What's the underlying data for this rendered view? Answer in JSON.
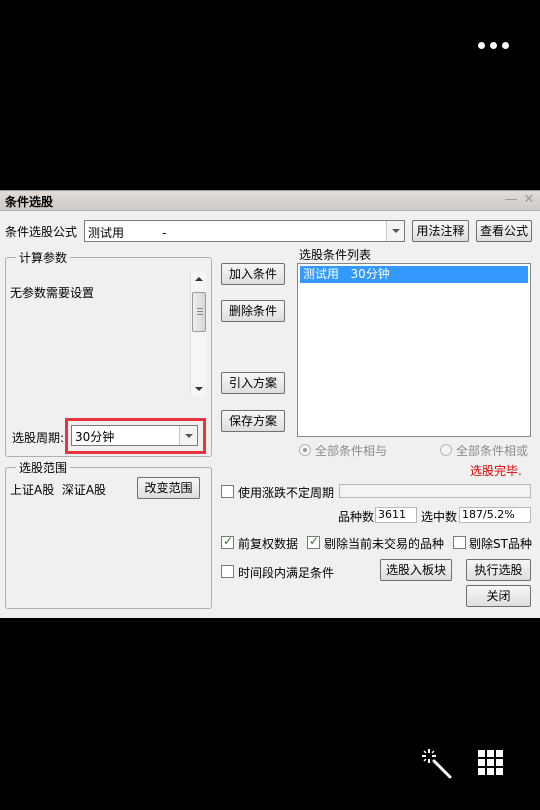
{
  "viewer": {
    "more_icon": "more-dots-icon",
    "wand_icon": "magic-wand-icon",
    "grid_icon": "grid-icon"
  },
  "dialog": {
    "title": "条件选股",
    "minimize_glyph": "—",
    "close_glyph": "✕",
    "formula_label": "条件选股公式",
    "formula_value": "测试用          -",
    "usage_button": "用法注释",
    "view_formula_button": "查看公式",
    "params_group": "计算参数",
    "params_text": "无参数需要设置",
    "period_label": "选股周期:",
    "period_value": "30分钟",
    "range_group": "选股范围",
    "range_text": "上证A股  深证A股",
    "change_range_button": "改变范围",
    "add_condition_button": "加入条件",
    "delete_condition_button": "删除条件",
    "import_plan_button": "引入方案",
    "save_plan_button": "保存方案",
    "list_title": "选股条件列表",
    "list_items": [
      "测试用   30分钟"
    ],
    "radio_and_label": "全部条件相与",
    "radio_or_label": "全部条件相或",
    "status_text": "选股完毕.",
    "limit_period_label": "使用涨跌不定周期",
    "count_label": "品种数",
    "count_value": "3611",
    "selected_label": "选中数",
    "selected_value": "187/5.2%",
    "forward_adjust_label": "前复权数据",
    "exclude_untraded_label": "剔除当前未交易的品种",
    "exclude_st_label": "剔除ST品种",
    "time_window_label": "时间段内满足条件",
    "to_block_button": "选股入板块",
    "run_button": "执行选股",
    "close_button": "关闭",
    "forward_adjust_checked": true,
    "exclude_untraded_checked": true,
    "exclude_st_checked": false,
    "limit_period_checked": false,
    "time_window_checked": false,
    "accent_color": "#3399ff",
    "highlight_color": "#e8343c",
    "status_color": "#e00000"
  }
}
